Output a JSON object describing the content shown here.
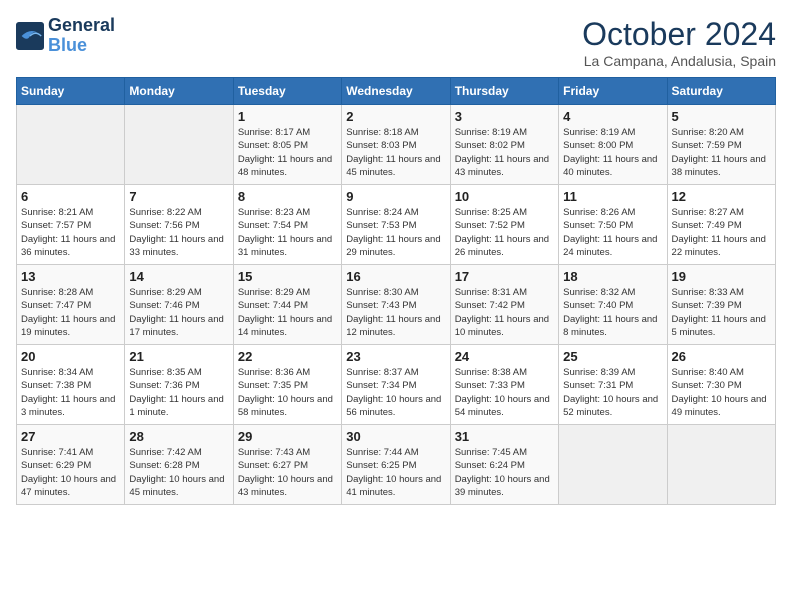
{
  "header": {
    "logo_line1": "General",
    "logo_line2": "Blue",
    "month": "October 2024",
    "location": "La Campana, Andalusia, Spain"
  },
  "weekdays": [
    "Sunday",
    "Monday",
    "Tuesday",
    "Wednesday",
    "Thursday",
    "Friday",
    "Saturday"
  ],
  "weeks": [
    [
      {
        "day": "",
        "info": ""
      },
      {
        "day": "",
        "info": ""
      },
      {
        "day": "1",
        "info": "Sunrise: 8:17 AM\nSunset: 8:05 PM\nDaylight: 11 hours and 48 minutes."
      },
      {
        "day": "2",
        "info": "Sunrise: 8:18 AM\nSunset: 8:03 PM\nDaylight: 11 hours and 45 minutes."
      },
      {
        "day": "3",
        "info": "Sunrise: 8:19 AM\nSunset: 8:02 PM\nDaylight: 11 hours and 43 minutes."
      },
      {
        "day": "4",
        "info": "Sunrise: 8:19 AM\nSunset: 8:00 PM\nDaylight: 11 hours and 40 minutes."
      },
      {
        "day": "5",
        "info": "Sunrise: 8:20 AM\nSunset: 7:59 PM\nDaylight: 11 hours and 38 minutes."
      }
    ],
    [
      {
        "day": "6",
        "info": "Sunrise: 8:21 AM\nSunset: 7:57 PM\nDaylight: 11 hours and 36 minutes."
      },
      {
        "day": "7",
        "info": "Sunrise: 8:22 AM\nSunset: 7:56 PM\nDaylight: 11 hours and 33 minutes."
      },
      {
        "day": "8",
        "info": "Sunrise: 8:23 AM\nSunset: 7:54 PM\nDaylight: 11 hours and 31 minutes."
      },
      {
        "day": "9",
        "info": "Sunrise: 8:24 AM\nSunset: 7:53 PM\nDaylight: 11 hours and 29 minutes."
      },
      {
        "day": "10",
        "info": "Sunrise: 8:25 AM\nSunset: 7:52 PM\nDaylight: 11 hours and 26 minutes."
      },
      {
        "day": "11",
        "info": "Sunrise: 8:26 AM\nSunset: 7:50 PM\nDaylight: 11 hours and 24 minutes."
      },
      {
        "day": "12",
        "info": "Sunrise: 8:27 AM\nSunset: 7:49 PM\nDaylight: 11 hours and 22 minutes."
      }
    ],
    [
      {
        "day": "13",
        "info": "Sunrise: 8:28 AM\nSunset: 7:47 PM\nDaylight: 11 hours and 19 minutes."
      },
      {
        "day": "14",
        "info": "Sunrise: 8:29 AM\nSunset: 7:46 PM\nDaylight: 11 hours and 17 minutes."
      },
      {
        "day": "15",
        "info": "Sunrise: 8:29 AM\nSunset: 7:44 PM\nDaylight: 11 hours and 14 minutes."
      },
      {
        "day": "16",
        "info": "Sunrise: 8:30 AM\nSunset: 7:43 PM\nDaylight: 11 hours and 12 minutes."
      },
      {
        "day": "17",
        "info": "Sunrise: 8:31 AM\nSunset: 7:42 PM\nDaylight: 11 hours and 10 minutes."
      },
      {
        "day": "18",
        "info": "Sunrise: 8:32 AM\nSunset: 7:40 PM\nDaylight: 11 hours and 8 minutes."
      },
      {
        "day": "19",
        "info": "Sunrise: 8:33 AM\nSunset: 7:39 PM\nDaylight: 11 hours and 5 minutes."
      }
    ],
    [
      {
        "day": "20",
        "info": "Sunrise: 8:34 AM\nSunset: 7:38 PM\nDaylight: 11 hours and 3 minutes."
      },
      {
        "day": "21",
        "info": "Sunrise: 8:35 AM\nSunset: 7:36 PM\nDaylight: 11 hours and 1 minute."
      },
      {
        "day": "22",
        "info": "Sunrise: 8:36 AM\nSunset: 7:35 PM\nDaylight: 10 hours and 58 minutes."
      },
      {
        "day": "23",
        "info": "Sunrise: 8:37 AM\nSunset: 7:34 PM\nDaylight: 10 hours and 56 minutes."
      },
      {
        "day": "24",
        "info": "Sunrise: 8:38 AM\nSunset: 7:33 PM\nDaylight: 10 hours and 54 minutes."
      },
      {
        "day": "25",
        "info": "Sunrise: 8:39 AM\nSunset: 7:31 PM\nDaylight: 10 hours and 52 minutes."
      },
      {
        "day": "26",
        "info": "Sunrise: 8:40 AM\nSunset: 7:30 PM\nDaylight: 10 hours and 49 minutes."
      }
    ],
    [
      {
        "day": "27",
        "info": "Sunrise: 7:41 AM\nSunset: 6:29 PM\nDaylight: 10 hours and 47 minutes."
      },
      {
        "day": "28",
        "info": "Sunrise: 7:42 AM\nSunset: 6:28 PM\nDaylight: 10 hours and 45 minutes."
      },
      {
        "day": "29",
        "info": "Sunrise: 7:43 AM\nSunset: 6:27 PM\nDaylight: 10 hours and 43 minutes."
      },
      {
        "day": "30",
        "info": "Sunrise: 7:44 AM\nSunset: 6:25 PM\nDaylight: 10 hours and 41 minutes."
      },
      {
        "day": "31",
        "info": "Sunrise: 7:45 AM\nSunset: 6:24 PM\nDaylight: 10 hours and 39 minutes."
      },
      {
        "day": "",
        "info": ""
      },
      {
        "day": "",
        "info": ""
      }
    ]
  ]
}
